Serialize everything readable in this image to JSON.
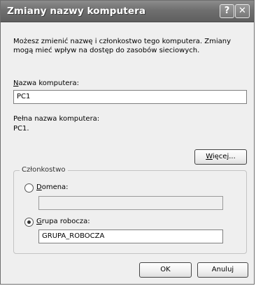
{
  "window": {
    "title": "Zmiany nazwy komputera",
    "help_label": "?",
    "close_label": "✕"
  },
  "description": "Możesz zmienić nazwę i członkostwo tego komputera. Zmiany mogą mieć wpływ na dostęp do zasobów sieciowych.",
  "computer_name": {
    "label_hotkey": "N",
    "label_rest": "azwa komputera:",
    "value": "PC1"
  },
  "full_name": {
    "label": "Pełna nazwa komputera:",
    "value": "PC1."
  },
  "more_button": {
    "hotkey": "W",
    "rest": "ięcej..."
  },
  "membership": {
    "legend": "Członkostwo",
    "domain": {
      "hotkey": "D",
      "rest": "omena:",
      "selected": false,
      "value": ""
    },
    "workgroup": {
      "hotkey": "G",
      "rest": "rupa robocza:",
      "selected": true,
      "value": "GRUPA_ROBOCZA"
    }
  },
  "buttons": {
    "ok": "OK",
    "cancel": "Anuluj"
  }
}
